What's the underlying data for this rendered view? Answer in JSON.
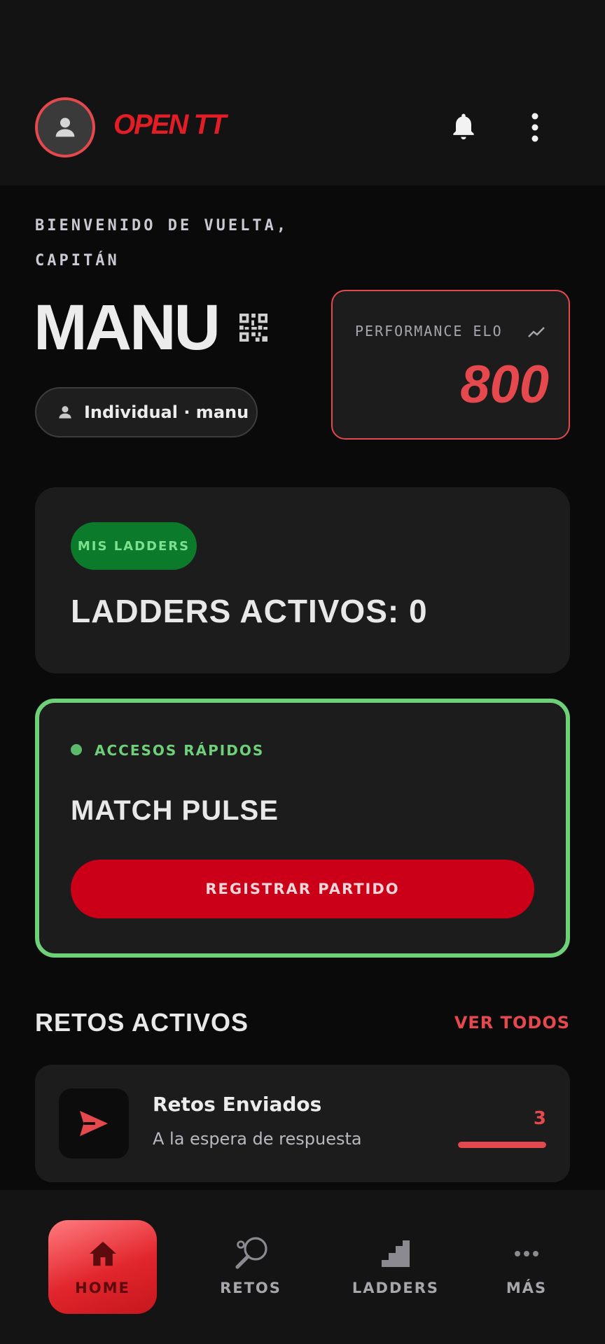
{
  "header": {
    "brand": "OPEN TT",
    "avatar_icon": "person-icon",
    "notification_icon": "bell-icon",
    "menu_icon": "more-vertical-icon"
  },
  "welcome": {
    "line1": "BIENVENIDO DE VUELTA,",
    "line2": "CAPITÁN",
    "username": "MANU",
    "qr_icon": "qr-code-icon",
    "profile_chip": "Individual · manu"
  },
  "elo": {
    "label": "PERFORMANCE ELO",
    "value": "800",
    "trend_icon": "trending-up-icon"
  },
  "ladders_card": {
    "pill": "MIS LADDERS",
    "title": "LADDERS ACTIVOS: 0"
  },
  "quick_access": {
    "label": "ACCESOS RÁPIDOS",
    "title": "MATCH PULSE",
    "button": "REGISTRAR PARTIDO"
  },
  "challenges": {
    "section_title": "RETOS ACTIVOS",
    "see_all": "VER TODOS",
    "items": [
      {
        "title": "Retos Enviados",
        "subtitle": "A la espera de respuesta",
        "count": "3",
        "icon": "send-icon",
        "progress": 1.0
      }
    ]
  },
  "bottom_nav": {
    "items": [
      {
        "label": "HOME",
        "icon": "home-icon",
        "active": true
      },
      {
        "label": "RETOS",
        "icon": "paddle-icon",
        "active": false
      },
      {
        "label": "LADDERS",
        "icon": "stairs-icon",
        "active": false
      },
      {
        "label": "MÁS",
        "icon": "more-horizontal-icon",
        "active": false
      }
    ]
  },
  "colors": {
    "accent_red": "#e5484d",
    "button_red": "#cb0018",
    "accent_green": "#6fd07a",
    "pill_green": "#0b7a2b",
    "background": "#0a0a0a",
    "card": "#1c1c1c"
  }
}
